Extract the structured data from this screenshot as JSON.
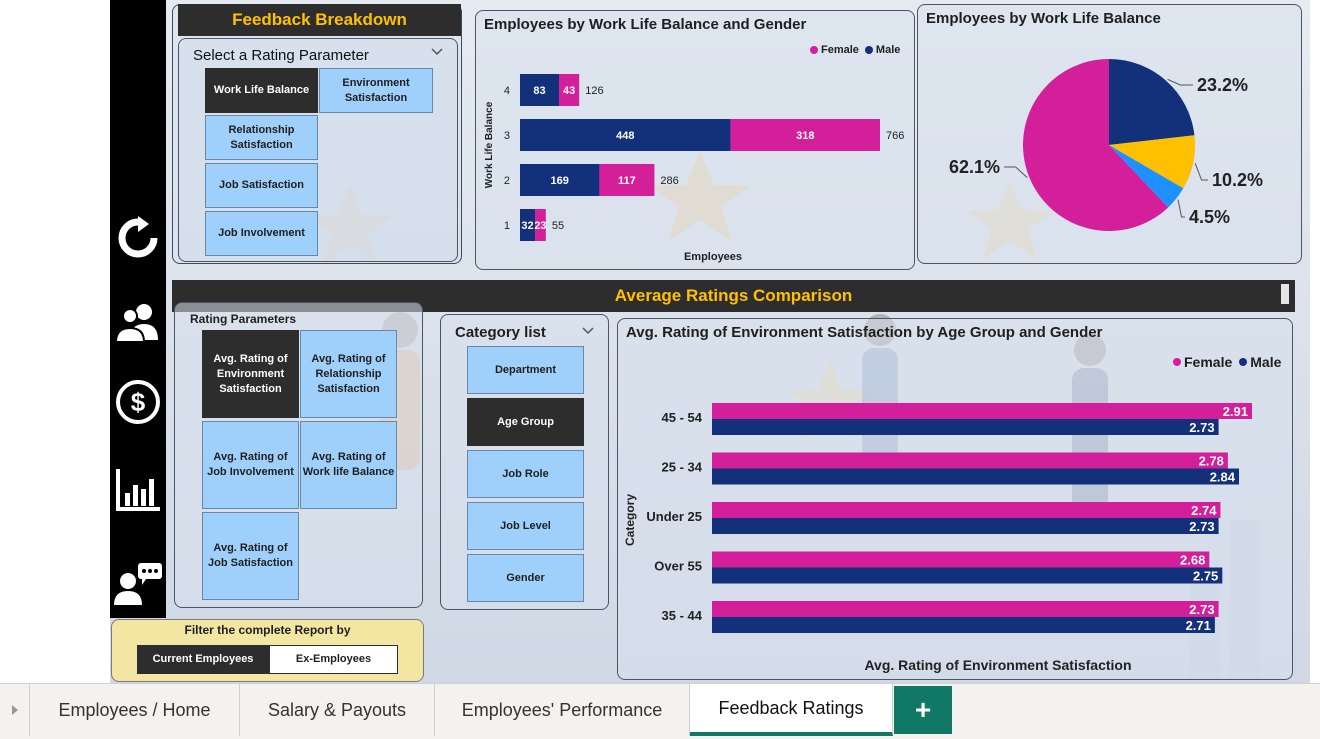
{
  "nav": {
    "icons": [
      "refresh-icon",
      "people-icon",
      "dollar-icon",
      "chart-icon",
      "feedback-icon"
    ]
  },
  "feedback_breakdown": {
    "title": "Feedback Breakdown",
    "selector_title": "Select a Rating Parameter",
    "buttons": [
      {
        "label": "Work Life Balance",
        "selected": true
      },
      {
        "label": "Environment Satisfaction",
        "selected": false
      },
      {
        "label": "Relationship Satisfaction",
        "selected": false
      },
      {
        "label": "Job Satisfaction",
        "selected": false
      },
      {
        "label": "Job Involvement",
        "selected": false
      }
    ]
  },
  "avg_section": {
    "title": "Average Ratings Comparison",
    "rating_params_title": "Rating Parameters",
    "rating_params": [
      {
        "label": "Avg. Rating of Environment Satisfaction",
        "selected": true
      },
      {
        "label": "Avg. Rating of Relationship Satisfaction",
        "selected": false
      },
      {
        "label": "Avg. Rating of Job Involvement",
        "selected": false
      },
      {
        "label": "Avg. Rating of Work life Balance",
        "selected": false
      },
      {
        "label": "Avg. Rating of Job Satisfaction",
        "selected": false
      }
    ],
    "category_title": "Category list",
    "categories": [
      {
        "label": "Department",
        "selected": false
      },
      {
        "label": "Age Group",
        "selected": true
      },
      {
        "label": "Job Role",
        "selected": false
      },
      {
        "label": "Job Level",
        "selected": false
      },
      {
        "label": "Gender",
        "selected": false
      }
    ]
  },
  "filter": {
    "title": "Filter the complete Report by",
    "options": [
      {
        "label": "Current Employees",
        "selected": true
      },
      {
        "label": "Ex-Employees",
        "selected": false
      }
    ]
  },
  "colors": {
    "female": "#d41f9a",
    "male": "#13307a",
    "yellow": "#ffc000",
    "blue": "#1e90ff",
    "accent_title": "#ffc000",
    "tab_accent": "#117865"
  },
  "chart_data": [
    {
      "type": "bar",
      "orientation": "horizontal-stacked",
      "title": "Employees by Work Life Balance and Gender",
      "xlabel": "Employees",
      "ylabel": "Work Life Balance",
      "categories": [
        "4",
        "3",
        "2",
        "1"
      ],
      "series": [
        {
          "name": "Male",
          "values": [
            83,
            448,
            169,
            32
          ]
        },
        {
          "name": "Female",
          "values": [
            43,
            318,
            117,
            23
          ]
        }
      ],
      "totals": [
        126,
        766,
        286,
        55
      ],
      "legend": [
        "Female",
        "Male"
      ],
      "legend_position": "top-right"
    },
    {
      "type": "pie",
      "title": "Employees by Work Life Balance",
      "slices": [
        {
          "value": 62.1,
          "label": "62.1%",
          "color": "#d41f9a"
        },
        {
          "value": 23.2,
          "label": "23.2%",
          "color": "#13307a"
        },
        {
          "value": 10.2,
          "label": "10.2%",
          "color": "#ffc000"
        },
        {
          "value": 4.5,
          "label": "4.5%",
          "color": "#1e90ff"
        }
      ]
    },
    {
      "type": "bar",
      "orientation": "horizontal-grouped",
      "title": "Avg. Rating of Environment Satisfaction by Age Group and Gender",
      "xlabel": "Avg. Rating of Environment Satisfaction",
      "ylabel": "Category",
      "categories": [
        "45 - 54",
        "25 - 34",
        "Under 25",
        "Over 55",
        "35 - 44"
      ],
      "series": [
        {
          "name": "Female",
          "values": [
            2.91,
            2.78,
            2.74,
            2.68,
            2.73
          ]
        },
        {
          "name": "Male",
          "values": [
            2.73,
            2.84,
            2.73,
            2.75,
            2.71
          ]
        }
      ],
      "legend": [
        "Female",
        "Male"
      ],
      "legend_position": "top-right"
    }
  ],
  "tabs": [
    {
      "label": "Employees / Home",
      "active": false
    },
    {
      "label": "Salary & Payouts",
      "active": false
    },
    {
      "label": "Employees' Performance",
      "active": false
    },
    {
      "label": "Feedback Ratings",
      "active": true
    }
  ],
  "add_tab_label": "+"
}
